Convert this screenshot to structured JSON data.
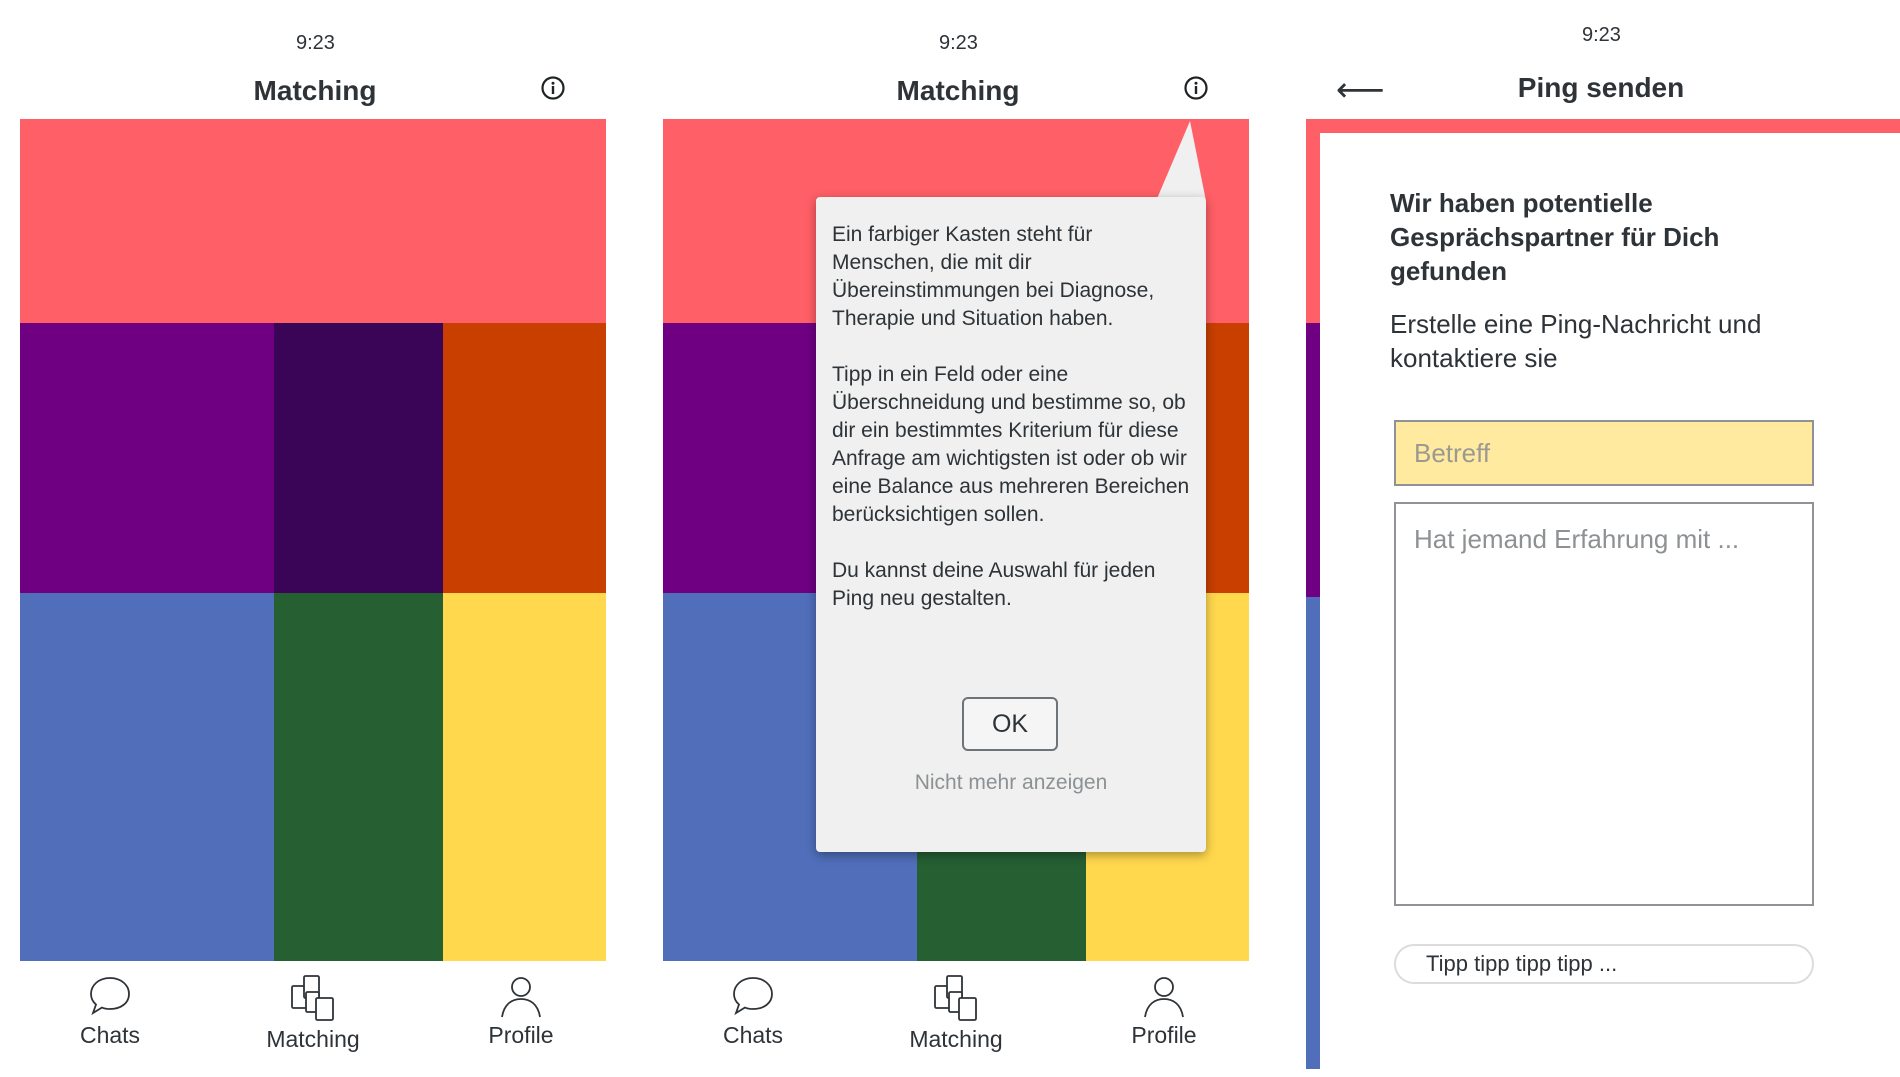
{
  "colors": {
    "coral": "#ff5f66",
    "purple": "#6e0081",
    "dark_purple": "#3a0556",
    "orange": "#c83f00",
    "blue": "#506eba",
    "green": "#255f32",
    "yellow": "#ffd84d",
    "subject_field": "#ffea9f"
  },
  "screen1": {
    "status_time": "9:23",
    "title": "Matching",
    "tabs": [
      {
        "label": "Chats",
        "icon": "chat-bubble-icon"
      },
      {
        "label": "Matching",
        "icon": "matching-cards-icon"
      },
      {
        "label": "Profile",
        "icon": "profile-person-icon"
      }
    ]
  },
  "screen2": {
    "status_time": "9:23",
    "title": "Matching",
    "popover": {
      "text": "Ein farbiger Kasten steht für Menschen, die mit dir Übereinstimmungen bei Diagnose, Therapie und Situation haben.\n\nTipp in ein Feld oder eine Überschneidung  und bestimme so, ob dir ein bestimmtes Kriterium für diese Anfrage am wichtigsten ist oder ob wir eine Balance aus mehreren Bereichen berücksichtigen sollen.\n\nDu kannst deine Auswahl für jeden Ping neu gestalten.",
      "ok_label": "OK",
      "dont_show_label": "Nicht mehr anzeigen"
    },
    "tabs": [
      {
        "label": "Chats",
        "icon": "chat-bubble-icon"
      },
      {
        "label": "Matching",
        "icon": "matching-cards-icon"
      },
      {
        "label": "Profile",
        "icon": "profile-person-icon"
      }
    ]
  },
  "screen3": {
    "status_time": "9:23",
    "back_icon": "back-arrow-icon",
    "back_glyph": "⟵",
    "title": "Ping senden",
    "heading": "Wir haben potentielle Gesprächspartner für Dich gefunden",
    "subheading": "Erstelle eine Ping-Nachricht und kontaktiere sie",
    "subject_placeholder": "Betreff",
    "message_placeholder": "Hat jemand Erfahrung mit ...",
    "typing_text": "Tipp tipp tipp tipp ..."
  }
}
